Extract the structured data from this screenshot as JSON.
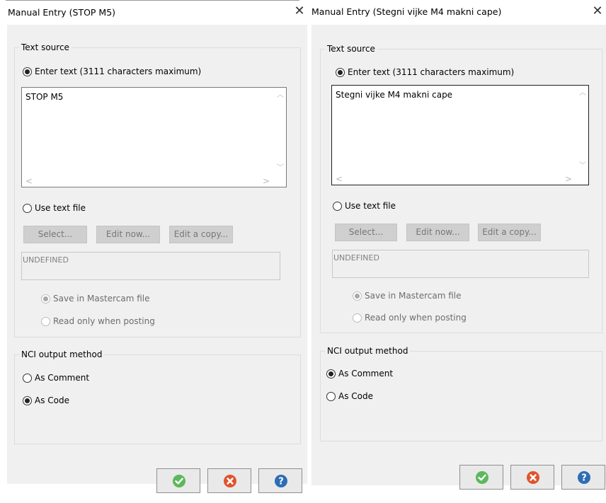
{
  "left": {
    "title": "Manual Entry (STOP M5)",
    "close_glyph": "✕",
    "text_source_label": "Text source",
    "enter_text_label": "Enter text (3111 characters maximum)",
    "text_value": "STOP M5",
    "use_text_file_label": "Use text file",
    "select_label": "Select...",
    "edit_now_label": "Edit now...",
    "edit_copy_label": "Edit a copy...",
    "file_path": "UNDEFINED",
    "save_in_mastercam_label": "Save in Mastercam file",
    "read_only_label": "Read only when posting",
    "nci_label": "NCI output method",
    "as_comment_label": "As Comment",
    "as_code_label": "As Code",
    "selected_text_source": "enter_text",
    "selected_nci": "as_code"
  },
  "right": {
    "title": "Manual Entry (Stegni vijke M4 makni cape)",
    "close_glyph": "✕",
    "text_source_label": "Text source",
    "enter_text_label": "Enter text (3111 characters maximum)",
    "text_value": "Stegni vijke M4 makni cape",
    "use_text_file_label": "Use text file",
    "select_label": "Select...",
    "edit_now_label": "Edit now...",
    "edit_copy_label": "Edit a copy...",
    "file_path": "UNDEFINED",
    "save_in_mastercam_label": "Save in Mastercam file",
    "read_only_label": "Read only when posting",
    "nci_label": "NCI output method",
    "as_comment_label": "As Comment",
    "as_code_label": "As Code",
    "selected_text_source": "enter_text",
    "selected_nci": "as_comment"
  },
  "icons": {
    "ok": "check-circle-icon",
    "cancel": "x-circle-icon",
    "help": "question-circle-icon"
  },
  "colors": {
    "ok_green": "#5cb85c",
    "cancel_orange": "#e0542c",
    "help_blue": "#2d6db5"
  }
}
